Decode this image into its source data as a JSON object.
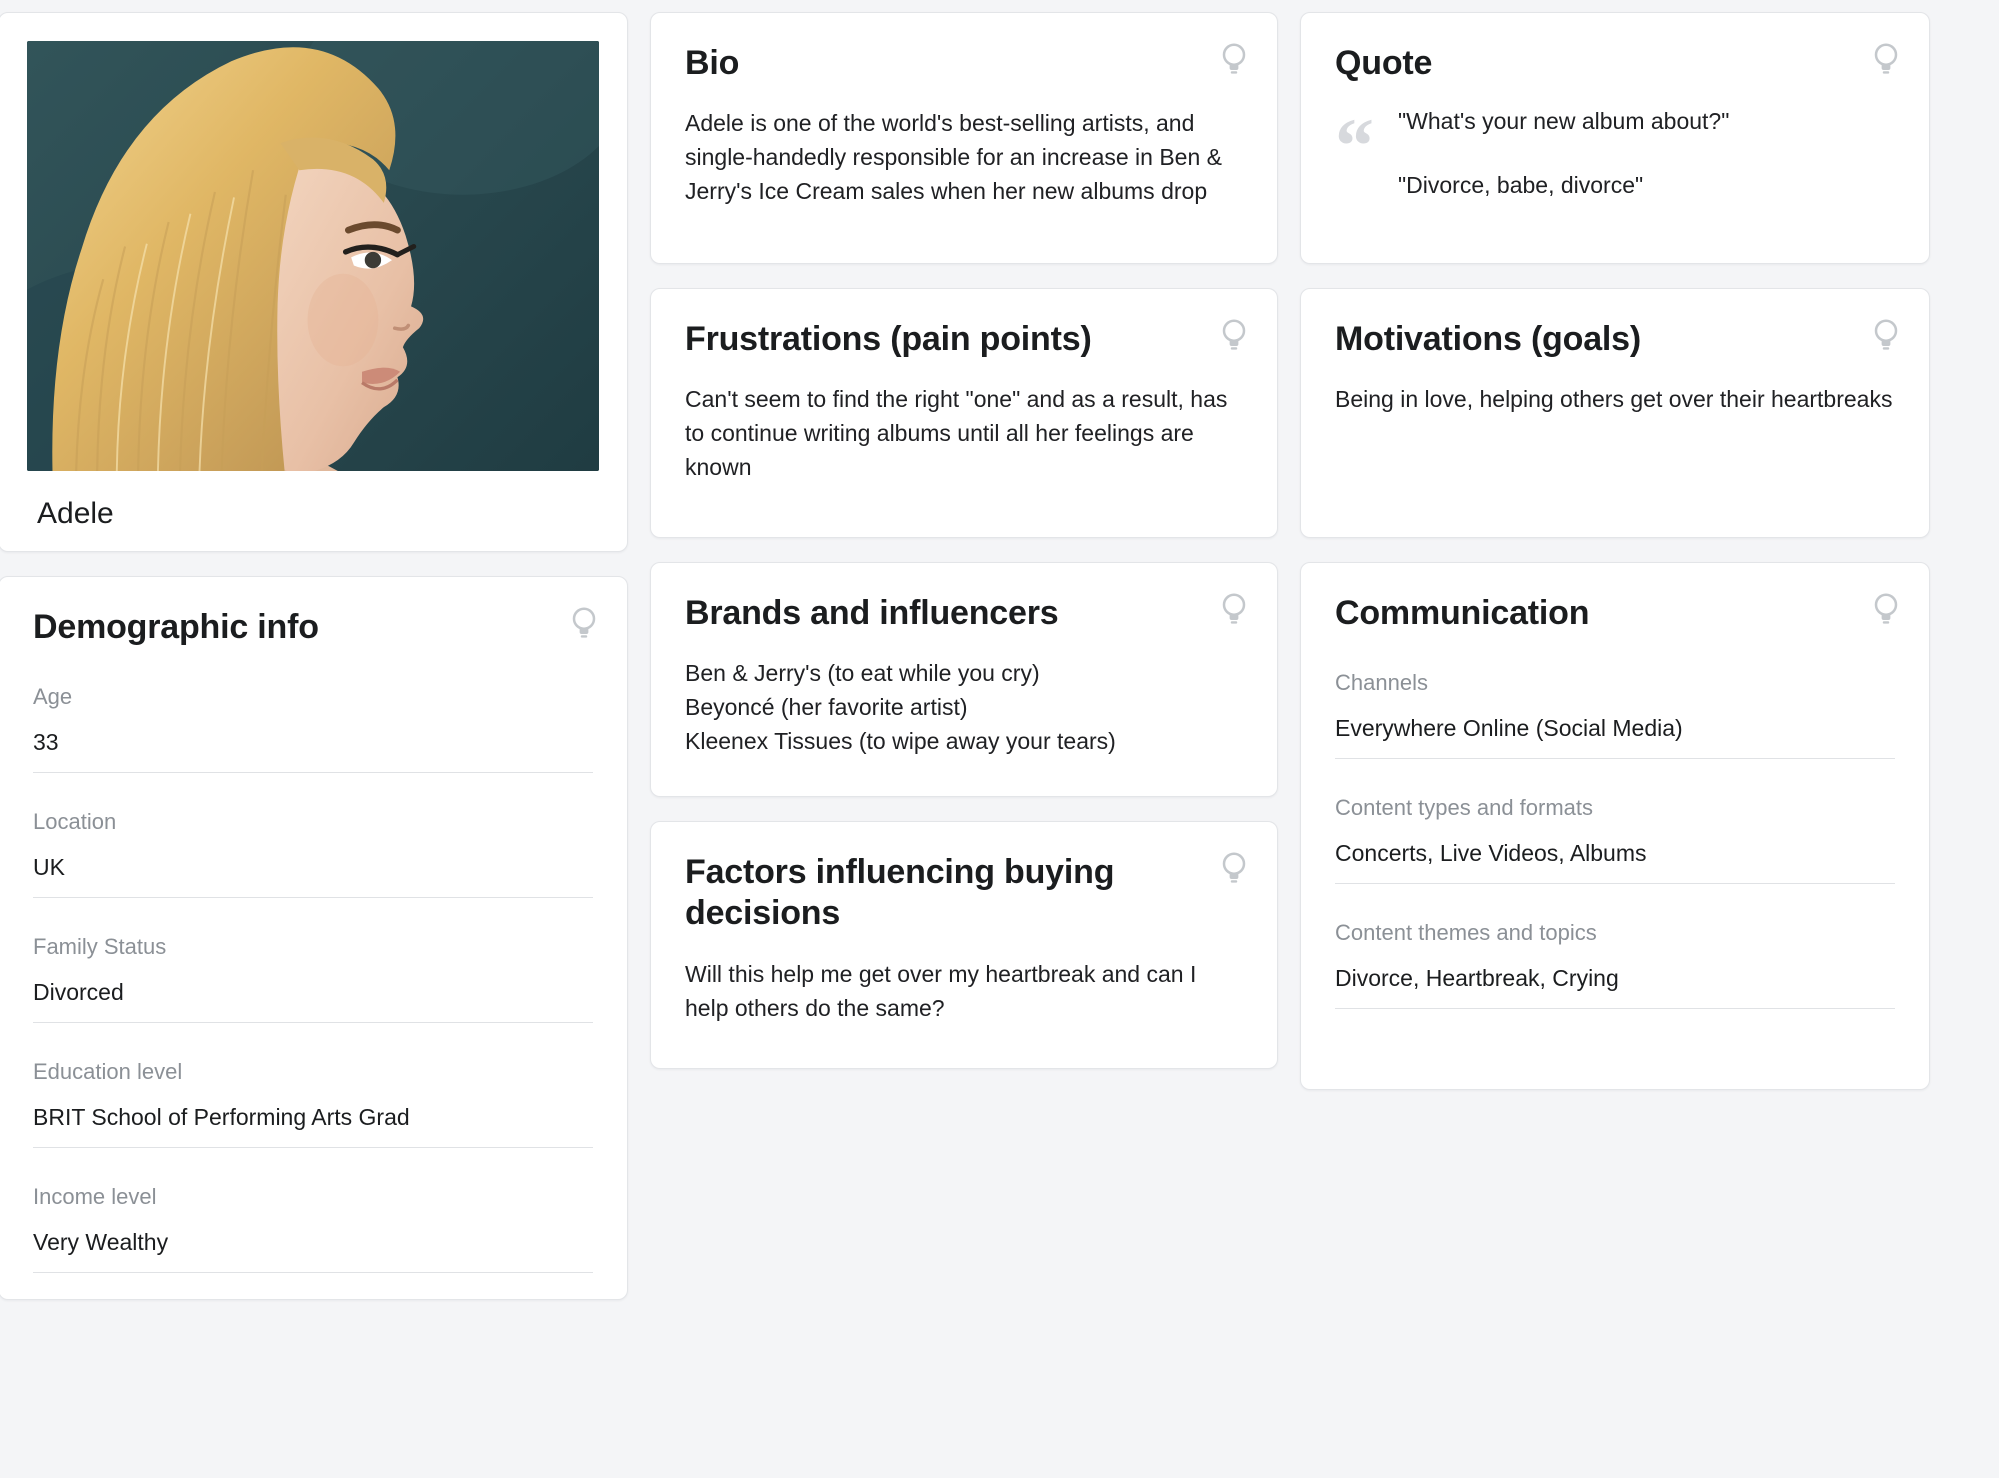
{
  "theme": {
    "page_background": "#f4f5f7",
    "card_background": "#ffffff",
    "card_border": "#e3e5e8",
    "title_color": "#1b1d1f",
    "label_color": "#8b9096",
    "icon_color": "#bfc3c7"
  },
  "profile": {
    "name": "Adele",
    "photo_alt": "Adele profile portrait",
    "icon": "portrait-photo"
  },
  "cards": {
    "bio": {
      "title": "Bio",
      "icon": "lightbulb-icon",
      "body": "Adele is one of the world's best-selling artists, and single-handedly responsible for an increase in Ben & Jerry's Ice Cream sales when her new albums drop"
    },
    "quote": {
      "title": "Quote",
      "icon": "lightbulb-icon",
      "quote_mark": "“",
      "line1": "\"What's your new album about?\"",
      "line2": "\"Divorce, babe, divorce\""
    },
    "frustrations": {
      "title": "Frustrations (pain points)",
      "icon": "lightbulb-icon",
      "body": "Can't seem to find the right \"one\" and as a result, has to continue writing albums until all her feelings are known"
    },
    "motivations": {
      "title": "Motivations (goals)",
      "icon": "lightbulb-icon",
      "body": "Being in love, helping others get over their heartbreaks"
    },
    "demographic": {
      "title": "Demographic info",
      "icon": "lightbulb-icon",
      "fields": [
        {
          "label": "Age",
          "value": "33"
        },
        {
          "label": "Location",
          "value": "UK"
        },
        {
          "label": "Family Status",
          "value": "Divorced"
        },
        {
          "label": "Education level",
          "value": "BRIT School of Performing Arts Grad"
        },
        {
          "label": "Income level",
          "value": "Very Wealthy"
        }
      ]
    },
    "brands": {
      "title": "Brands and influencers",
      "icon": "lightbulb-icon",
      "body": "Ben & Jerry's (to eat while you cry)\nBeyoncé (her favorite artist)\nKleenex Tissues (to wipe away your tears)"
    },
    "factors": {
      "title": "Factors influencing buying decisions",
      "icon": "lightbulb-icon",
      "body": "Will this help me get over my heartbreak and can I help others do the same?"
    },
    "communication": {
      "title": "Communication",
      "icon": "lightbulb-icon",
      "fields": [
        {
          "label": "Channels",
          "value": "Everywhere Online (Social Media)"
        },
        {
          "label": "Content types and formats",
          "value": "Concerts, Live Videos, Albums"
        },
        {
          "label": "Content themes and topics",
          "value": "Divorce, Heartbreak, Crying"
        }
      ]
    }
  }
}
